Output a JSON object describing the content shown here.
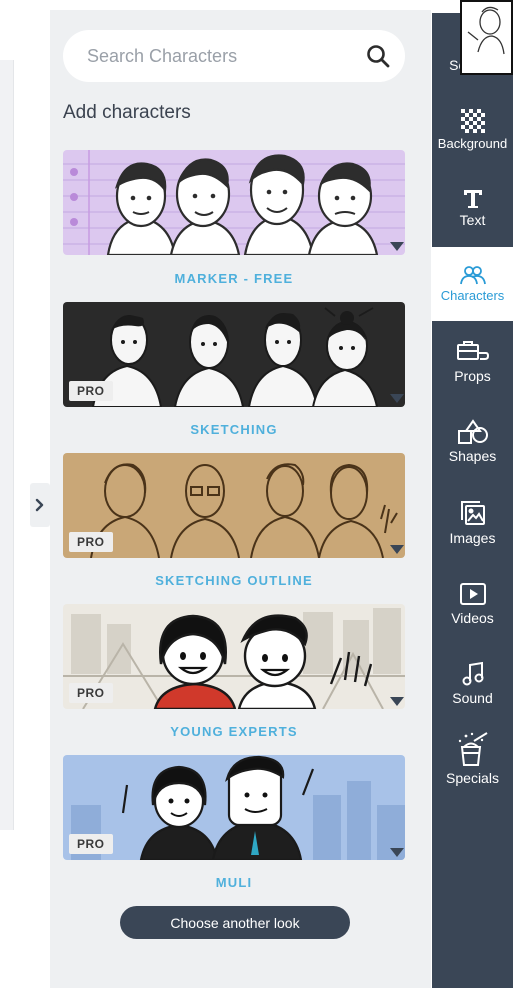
{
  "panel": {
    "search_placeholder": "Search Characters",
    "section_title": "Add characters",
    "cards": [
      {
        "label": "MARKER - FREE",
        "pro": false,
        "style_color": "#dcc8ef"
      },
      {
        "label": "SKETCHING",
        "pro": true,
        "pro_label": "PRO",
        "style_color": "#2a2a2a"
      },
      {
        "label": "SKETCHING OUTLINE",
        "pro": true,
        "pro_label": "PRO",
        "style_color": "#c9a777"
      },
      {
        "label": "YOUNG EXPERTS",
        "pro": true,
        "pro_label": "PRO",
        "style_color": "#ece9e2"
      },
      {
        "label": "MULI",
        "pro": true,
        "pro_label": "PRO",
        "style_color": "#a8c2e8"
      }
    ],
    "choose_button": "Choose another look"
  },
  "rail": {
    "items": [
      {
        "label": "Scenes",
        "icon": "scenes-icon"
      },
      {
        "label": "Background",
        "icon": "background-icon"
      },
      {
        "label": "Text",
        "icon": "text-icon"
      },
      {
        "label": "Characters",
        "icon": "characters-icon",
        "active": true
      },
      {
        "label": "Props",
        "icon": "props-icon"
      },
      {
        "label": "Shapes",
        "icon": "shapes-icon"
      },
      {
        "label": "Images",
        "icon": "images-icon"
      },
      {
        "label": "Videos",
        "icon": "videos-icon"
      },
      {
        "label": "Sound",
        "icon": "sound-icon"
      },
      {
        "label": "Specials",
        "icon": "specials-icon"
      }
    ]
  },
  "colors": {
    "accent": "#2a9bd6",
    "card_label": "#4fb0dc",
    "rail_bg": "#3a4656",
    "panel_bg": "#eef0f2"
  }
}
